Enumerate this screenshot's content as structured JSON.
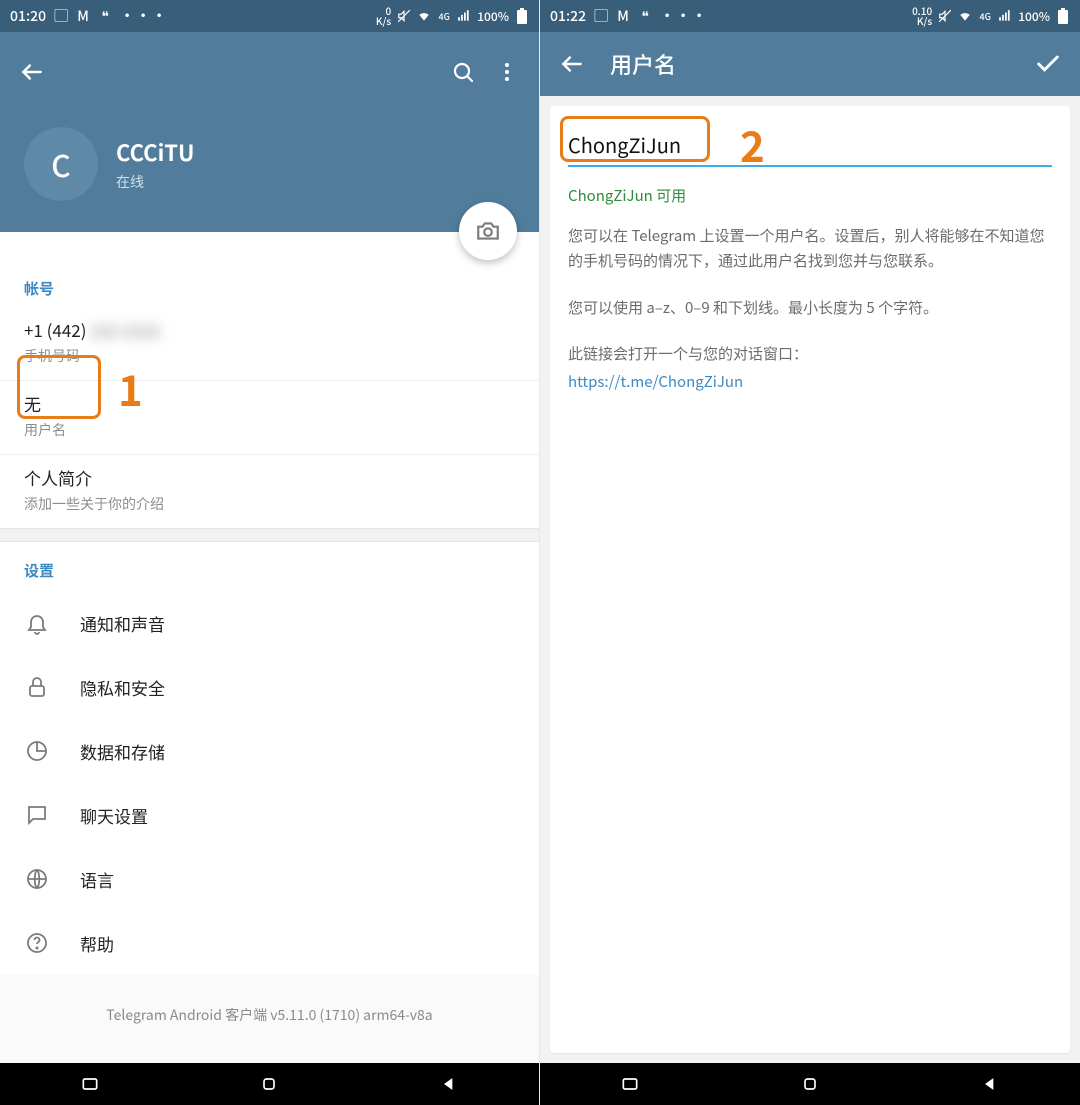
{
  "left": {
    "status": {
      "time": "01:20",
      "more": "···",
      "speed": "0\nK/s",
      "battery": "100%"
    },
    "profile": {
      "initial": "C",
      "name": "CCCiTU",
      "status": "在线"
    },
    "account": {
      "header": "帐号",
      "phone_value": "+1 (442)",
      "phone_label": "手机号码",
      "username_value": "无",
      "username_label": "用户名",
      "bio_value": "个人简介",
      "bio_label": "添加一些关于你的介绍"
    },
    "settings": {
      "header": "设置",
      "items": [
        "通知和声音",
        "隐私和安全",
        "数据和存储",
        "聊天设置",
        "语言",
        "帮助"
      ]
    },
    "footer": "Telegram Android 客户端 v5.11.0 (1710) arm64-v8a",
    "annotation": "1"
  },
  "right": {
    "status": {
      "time": "01:22",
      "more": "···",
      "speed": "0.10\nK/s",
      "battery": "100%"
    },
    "title": "用户名",
    "input_value": "ChongZiJun",
    "available": "ChongZiJun 可用",
    "desc1": "您可以在 Telegram 上设置一个用户名。设置后，别人将能够在不知道您的手机号码的情况下，通过此用户名找到您并与您联系。",
    "desc2": "您可以使用 a–z、0–9 和下划线。最小长度为 5 个字符。",
    "desc3": "此链接会打开一个与您的对话窗口：",
    "link": "https://t.me/ChongZiJun",
    "annotation": "2"
  }
}
